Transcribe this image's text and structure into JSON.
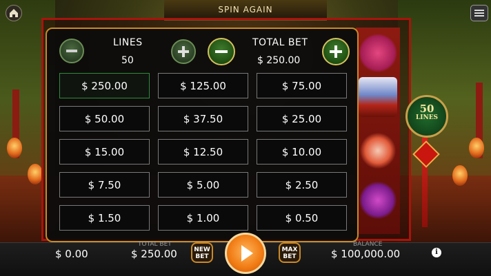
{
  "header": {
    "title": "SPIN AGAIN"
  },
  "medal": {
    "number": "50",
    "text": "LINES"
  },
  "panel": {
    "lines_label": "LINES",
    "lines_value": "50",
    "total_bet_label": "TOTAL BET",
    "total_bet_value": "$ 250.00",
    "bet_options": [
      "$ 250.00",
      "$ 125.00",
      "$ 75.00",
      "$ 50.00",
      "$ 37.50",
      "$ 25.00",
      "$ 15.00",
      "$ 12.50",
      "$ 10.00",
      "$ 7.50",
      "$ 5.00",
      "$ 2.50",
      "$ 1.50",
      "$ 1.00",
      "$ 0.50"
    ],
    "selected_option": "$ 250.00"
  },
  "bottom": {
    "win_value": "$ 0.00",
    "bet_label": "TOTAL BET",
    "bet_value": "$ 250.00",
    "new_bet_label": "NEW BET",
    "max_bet_label": "MAX BET",
    "balance_label": "BALANCE",
    "balance_value": "$ 100,000.00",
    "info": "i"
  },
  "colors": {
    "panel_border": "#c98a2a",
    "selected_border": "#2f8c3a",
    "spin_button": "#f07a12",
    "reel_frame": "#a8140c"
  }
}
